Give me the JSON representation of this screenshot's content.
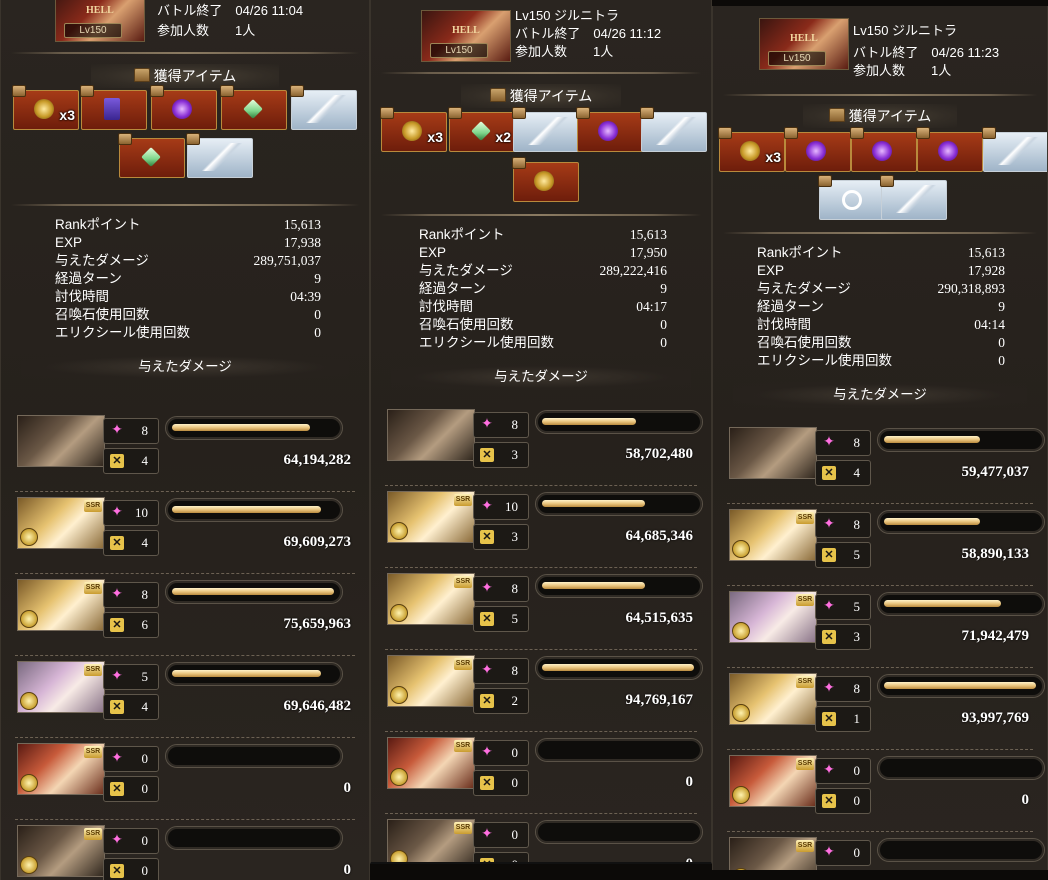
{
  "item_section_title": "獲得アイテム",
  "damage_section_title": "与えたダメージ",
  "hell_label": "HELL",
  "ssr_label": "SSR",
  "stat_labels": [
    "Rankポイント",
    "EXP",
    "与えたダメージ",
    "経過ターン",
    "討伐時間",
    "召喚石使用回数",
    "エリクシール使用回数"
  ],
  "panels": [
    {
      "title_line": "",
      "battle_end": "バトル終了　04/26 11:04",
      "participants": "参加人数　　1人",
      "thumb_level": "Lv150",
      "stats": [
        "15,613",
        "17,938",
        "289,751,037",
        "9",
        "04:39",
        "0",
        "0"
      ],
      "items": [
        {
          "kind": "gold",
          "count": "x3"
        },
        {
          "kind": "book",
          "count": ""
        },
        {
          "kind": "purple",
          "count": ""
        },
        {
          "kind": "green",
          "count": ""
        },
        {
          "kind": "blade",
          "count": ""
        },
        {
          "kind": "green",
          "count": ""
        },
        {
          "kind": "blade",
          "count": ""
        }
      ],
      "party": [
        {
          "portrait": "dark",
          "stars": "8",
          "cross": "4",
          "gauge": 0.85,
          "damage": "64,194,282"
        },
        {
          "portrait": "blonde",
          "stars": "10",
          "cross": "4",
          "gauge": 0.92,
          "damage": "69,609,273"
        },
        {
          "portrait": "blonde",
          "stars": "8",
          "cross": "6",
          "gauge": 1.0,
          "damage": "75,659,963"
        },
        {
          "portrait": "pink",
          "stars": "5",
          "cross": "4",
          "gauge": 0.92,
          "damage": "69,646,482"
        },
        {
          "portrait": "red",
          "stars": "0",
          "cross": "0",
          "gauge": 0,
          "damage": "0"
        },
        {
          "portrait": "dark",
          "stars": "0",
          "cross": "0",
          "gauge": 0,
          "damage": "0"
        }
      ]
    },
    {
      "title_line": "Lv150 ジルニトラ",
      "battle_end": "バトル終了　04/26 11:12",
      "participants": "参加人数　　1人",
      "thumb_level": "Lv150",
      "stats": [
        "15,613",
        "17,950",
        "289,222,416",
        "9",
        "04:17",
        "0",
        "0"
      ],
      "items": [
        {
          "kind": "gold",
          "count": "x3"
        },
        {
          "kind": "green",
          "count": "x2"
        },
        {
          "kind": "blade",
          "count": ""
        },
        {
          "kind": "purple",
          "count": ""
        },
        {
          "kind": "blade",
          "count": ""
        },
        {
          "kind": "gold",
          "count": ""
        }
      ],
      "party": [
        {
          "portrait": "dark",
          "stars": "8",
          "cross": "3",
          "gauge": 0.62,
          "damage": "58,702,480"
        },
        {
          "portrait": "blonde",
          "stars": "10",
          "cross": "3",
          "gauge": 0.68,
          "damage": "64,685,346"
        },
        {
          "portrait": "blonde",
          "stars": "8",
          "cross": "5",
          "gauge": 0.68,
          "damage": "64,515,635"
        },
        {
          "portrait": "blonde",
          "stars": "8",
          "cross": "2",
          "gauge": 1.0,
          "damage": "94,769,167"
        },
        {
          "portrait": "red",
          "stars": "0",
          "cross": "0",
          "gauge": 0,
          "damage": "0"
        },
        {
          "portrait": "dark",
          "stars": "0",
          "cross": "0",
          "gauge": 0,
          "damage": "0"
        }
      ]
    },
    {
      "title_line": "Lv150 ジルニトラ",
      "battle_end": "バトル終了　04/26 11:23",
      "participants": "参加人数　　1人",
      "thumb_level": "Lv150",
      "stats": [
        "15,613",
        "17,928",
        "290,318,893",
        "9",
        "04:14",
        "0",
        "0"
      ],
      "items": [
        {
          "kind": "gold",
          "count": "x3"
        },
        {
          "kind": "purple",
          "count": ""
        },
        {
          "kind": "purple",
          "count": ""
        },
        {
          "kind": "purple",
          "count": ""
        },
        {
          "kind": "blade",
          "count": ""
        },
        {
          "kind": "ring",
          "count": ""
        },
        {
          "kind": "blade",
          "count": ""
        }
      ],
      "party": [
        {
          "portrait": "dark",
          "stars": "8",
          "cross": "4",
          "gauge": 0.63,
          "damage": "59,477,037"
        },
        {
          "portrait": "blonde",
          "stars": "8",
          "cross": "5",
          "gauge": 0.63,
          "damage": "58,890,133"
        },
        {
          "portrait": "pink",
          "stars": "5",
          "cross": "3",
          "gauge": 0.77,
          "damage": "71,942,479"
        },
        {
          "portrait": "blonde",
          "stars": "8",
          "cross": "1",
          "gauge": 1.0,
          "damage": "93,997,769"
        },
        {
          "portrait": "red",
          "stars": "0",
          "cross": "0",
          "gauge": 0,
          "damage": "0"
        },
        {
          "portrait": "dark",
          "stars": "0",
          "cross": "0",
          "gauge": 0,
          "damage": "0"
        }
      ]
    }
  ]
}
